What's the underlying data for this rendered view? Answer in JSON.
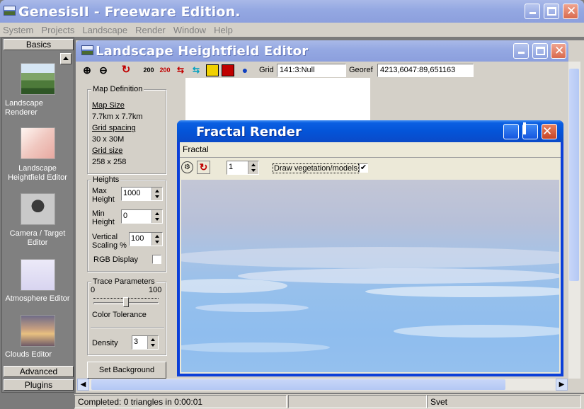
{
  "app": {
    "title": "GenesisII - Freeware Edition.",
    "menu": [
      "System",
      "Projects",
      "Landscape",
      "Render",
      "Window",
      "Help"
    ]
  },
  "sidebar": {
    "tab_basics": "Basics",
    "tab_advanced": "Advanced",
    "tab_plugins": "Plugins",
    "items": [
      {
        "label": "Landscape Renderer",
        "icon": "landscape-renderer-icon"
      },
      {
        "label": "Landscape Heightfield Editor",
        "icon": "heightfield-editor-icon"
      },
      {
        "label": "Camera / Target Editor",
        "icon": "camera-icon"
      },
      {
        "label": "Atmosphere Editor",
        "icon": "atmosphere-icon"
      },
      {
        "label": "Clouds Editor",
        "icon": "clouds-icon"
      }
    ]
  },
  "editor": {
    "title": "Landscape Heightfield Editor",
    "toolbar": {
      "btn_200a": "200",
      "btn_200b": "200",
      "grid_label": "Grid",
      "grid_value": "141:3:Null",
      "georef_label": "Georef",
      "georef_value": "4213,6047:89,651163"
    },
    "map_definition": {
      "title": "Map Definition",
      "map_size_label": "Map Size",
      "map_size_value": "7.7km x 7.7km",
      "grid_spacing_label": "Grid spacing",
      "grid_spacing_value": "30 x 30M",
      "grid_size_label": "Grid size",
      "grid_size_value": "258 x 258"
    },
    "heights": {
      "title": "Heights",
      "max_label": "Max Height",
      "max_value": "1000",
      "min_label": "Min Height",
      "min_value": "0",
      "vscale_label": "Vertical Scaling %",
      "vscale_value": "100",
      "rgb_label": "RGB Display"
    },
    "trace": {
      "title": "Trace Parameters",
      "min": "0",
      "max": "100",
      "tolerance_label": "Color Tolerance",
      "tolerance_value": 0.5,
      "density_label": "Density",
      "density_value": "3"
    },
    "set_background": "Set Background"
  },
  "fractal": {
    "title": "Fractal Render",
    "menu": "Fractal",
    "level_value": "1",
    "draw_veg_label": "Draw vegetation/models",
    "draw_veg_checked": "✔"
  },
  "status": {
    "message": "Completed: 0 triangles in 0:00:01",
    "user": "Svet"
  }
}
